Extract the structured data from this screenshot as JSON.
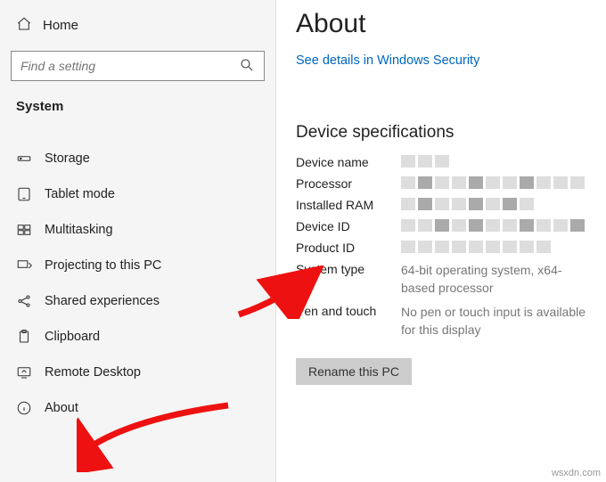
{
  "sidebar": {
    "home_label": "Home",
    "search_placeholder": "Find a setting",
    "section_title": "System",
    "items": [
      {
        "label": "Storage",
        "icon": "storage-icon"
      },
      {
        "label": "Tablet mode",
        "icon": "tablet-icon"
      },
      {
        "label": "Multitasking",
        "icon": "multitasking-icon"
      },
      {
        "label": "Projecting to this PC",
        "icon": "projecting-icon"
      },
      {
        "label": "Shared experiences",
        "icon": "shared-icon"
      },
      {
        "label": "Clipboard",
        "icon": "clipboard-icon"
      },
      {
        "label": "Remote Desktop",
        "icon": "remote-desktop-icon"
      },
      {
        "label": "About",
        "icon": "about-icon"
      }
    ]
  },
  "main": {
    "page_title": "About",
    "security_link": "See details in Windows Security",
    "specs_heading": "Device specifications",
    "specs": {
      "device_name_label": "Device name",
      "processor_label": "Processor",
      "installed_ram_label": "Installed RAM",
      "device_id_label": "Device ID",
      "product_id_label": "Product ID",
      "system_type_label": "System type",
      "system_type_value": "64-bit operating system, x64-based processor",
      "pen_touch_label": "Pen and touch",
      "pen_touch_value": "No pen or touch input is available for this display"
    },
    "rename_button": "Rename this PC"
  },
  "watermark": "wsxdn.com"
}
